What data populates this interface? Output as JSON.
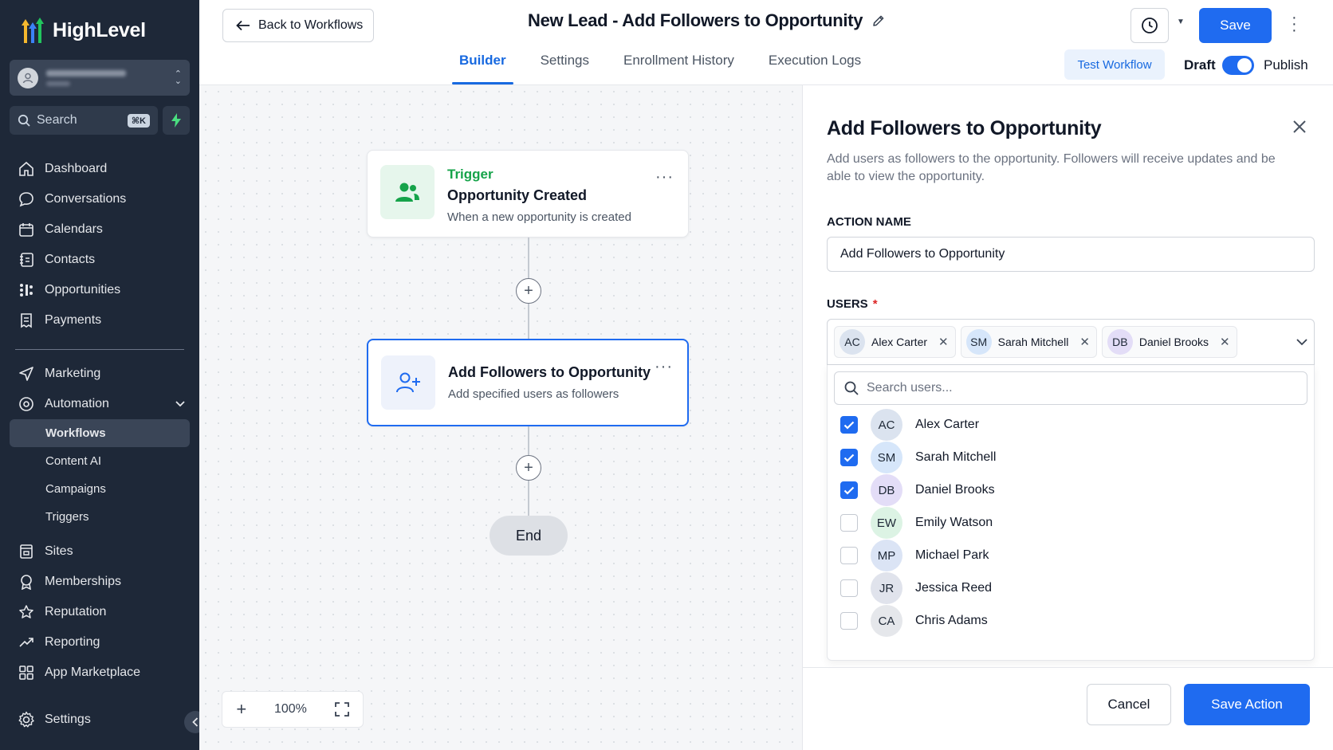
{
  "brand": {
    "name": "HighLevel"
  },
  "sidebar": {
    "search_placeholder": "Search",
    "search_shortcut": "⌘K",
    "nav_main": [
      {
        "label": "Dashboard",
        "icon": "home-icon"
      },
      {
        "label": "Conversations",
        "icon": "chat-icon"
      },
      {
        "label": "Calendars",
        "icon": "calendar-icon"
      },
      {
        "label": "Contacts",
        "icon": "contacts-icon"
      },
      {
        "label": "Opportunities",
        "icon": "opportunities-icon"
      },
      {
        "label": "Payments",
        "icon": "payments-icon"
      }
    ],
    "nav_group": [
      {
        "label": "Marketing",
        "icon": "send-icon"
      },
      {
        "label": "Automation",
        "icon": "automation-icon"
      }
    ],
    "automation_sub": [
      "Workflows",
      "Content AI",
      "Campaigns",
      "Triggers"
    ],
    "nav_bottom": [
      {
        "label": "Sites",
        "icon": "sites-icon"
      },
      {
        "label": "Memberships",
        "icon": "membership-icon"
      },
      {
        "label": "Reputation",
        "icon": "star-icon"
      },
      {
        "label": "Reporting",
        "icon": "trend-icon"
      },
      {
        "label": "App Marketplace",
        "icon": "grid-icon"
      }
    ],
    "settings_label": "Settings"
  },
  "header": {
    "back_label": "Back to Workflows",
    "title": "New Lead - Add Followers to Opportunity",
    "tabs": [
      "Builder",
      "Settings",
      "Enrollment History",
      "Execution Logs"
    ],
    "active_tab": "Builder",
    "save_label": "Save",
    "test_label": "Test Workflow",
    "draft_label": "Draft",
    "publish_label": "Publish"
  },
  "canvas": {
    "trigger": {
      "kicker": "Trigger",
      "title": "Opportunity Created",
      "subtitle": "When a new opportunity is created"
    },
    "action": {
      "title": "Add Followers to Opportunity",
      "subtitle": "Add specified users as followers"
    },
    "end_label": "End",
    "zoom": "100%"
  },
  "panel": {
    "title": "Add Followers to Opportunity",
    "description": "Add users as followers to the opportunity. Followers will receive updates and be able to view the opportunity.",
    "action_name_label": "ACTION NAME",
    "action_name_value": "Add Followers to Opportunity",
    "users_label": "USERS",
    "users_required": "*",
    "selected": [
      {
        "initials": "AC",
        "name": "Alex Carter"
      },
      {
        "initials": "SM",
        "name": "Sarah Mitchell"
      },
      {
        "initials": "DB",
        "name": "Daniel Brooks"
      }
    ],
    "search_placeholder": "Search users...",
    "options": [
      {
        "initials": "AC",
        "name": "Alex Carter",
        "checked": true,
        "color": "#dbe3ef"
      },
      {
        "initials": "SM",
        "name": "Sarah Mitchell",
        "checked": true,
        "color": "#d6e6fa"
      },
      {
        "initials": "DB",
        "name": "Daniel Brooks",
        "checked": true,
        "color": "#e3ddf7"
      },
      {
        "initials": "EW",
        "name": "Emily Watson",
        "checked": false,
        "color": "#dcf3e4"
      },
      {
        "initials": "MP",
        "name": "Michael Park",
        "checked": false,
        "color": "#dbe4f5"
      },
      {
        "initials": "JR",
        "name": "Jessica Reed",
        "checked": false,
        "color": "#e0e3ec"
      },
      {
        "initials": "CA",
        "name": "Chris Adams",
        "checked": false,
        "color": "#e5e7eb"
      }
    ],
    "cancel_label": "Cancel",
    "save_action_label": "Save Action"
  },
  "colors": {
    "accent": "#1f6bf0",
    "sidebar_bg": "#1e2838",
    "success": "#16a34a"
  }
}
